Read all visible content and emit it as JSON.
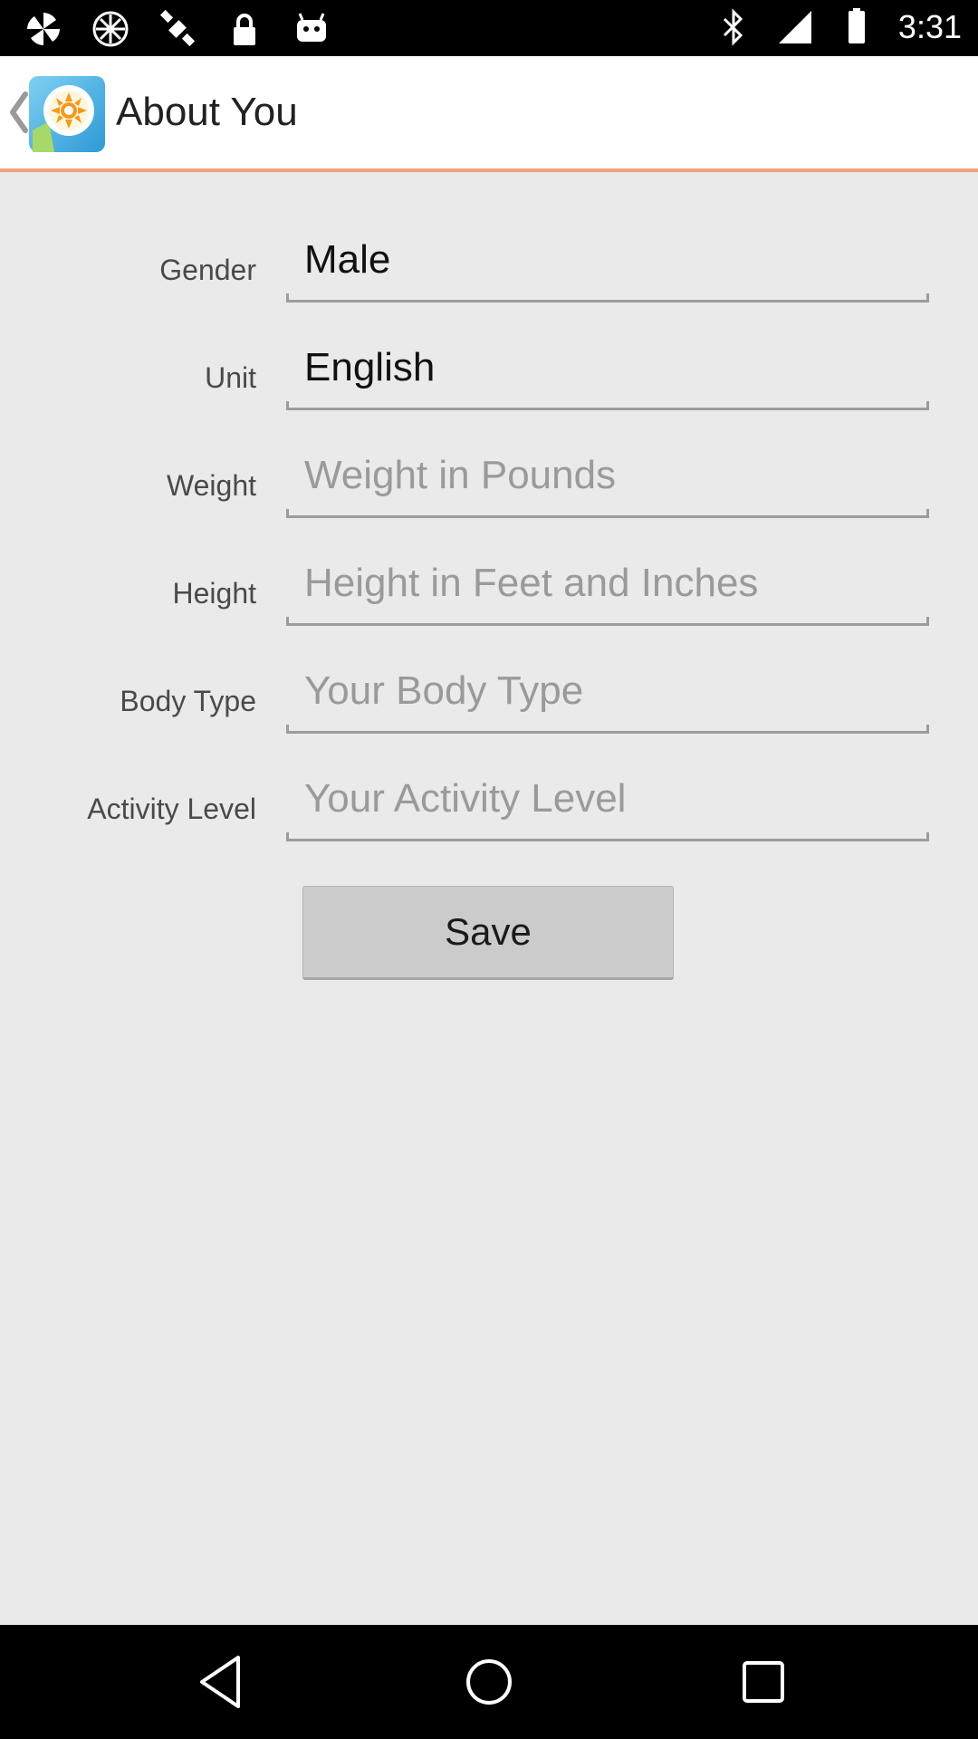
{
  "status_bar": {
    "time": "3:31",
    "left_icons": [
      "pinwheel-icon",
      "pinwheel-icon",
      "fake-gps-icon",
      "lock-icon",
      "android-icon"
    ],
    "right_icons": [
      "bluetooth-icon",
      "signal-icon",
      "battery-icon"
    ]
  },
  "action_bar": {
    "title": "About You",
    "divider_color": "#f4a27c"
  },
  "form": {
    "fields": [
      {
        "label": "Gender",
        "value": "Male",
        "placeholder": ""
      },
      {
        "label": "Unit",
        "value": "English",
        "placeholder": ""
      },
      {
        "label": "Weight",
        "value": "",
        "placeholder": "Weight in Pounds"
      },
      {
        "label": "Height",
        "value": "",
        "placeholder": "Height in Feet and Inches"
      },
      {
        "label": "Body Type",
        "value": "",
        "placeholder": "Your Body Type"
      },
      {
        "label": "Activity Level",
        "value": "",
        "placeholder": "Your Activity Level"
      }
    ],
    "save_label": "Save"
  },
  "nav_bar": {
    "buttons": [
      "back-icon",
      "home-icon",
      "recents-icon"
    ]
  }
}
